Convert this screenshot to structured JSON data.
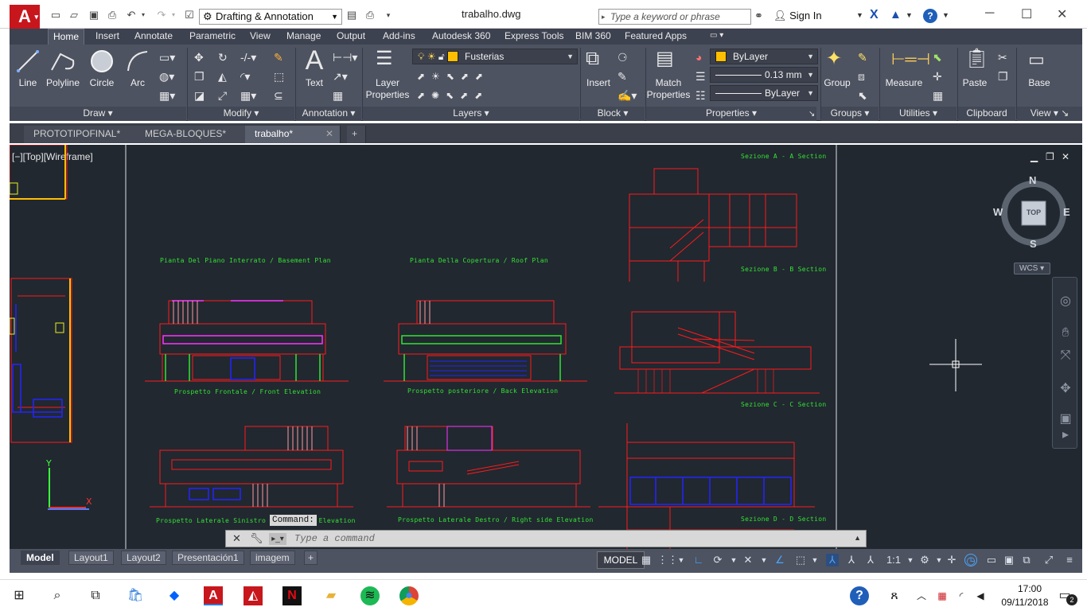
{
  "titlebar": {
    "app_logo": "A",
    "workspace": "Drafting & Annotation",
    "document_title": "trabalho.dwg",
    "search_placeholder": "Type a keyword or phrase",
    "signin_label": "Sign In"
  },
  "ribbon_tabs": [
    "Home",
    "Insert",
    "Annotate",
    "Parametric",
    "View",
    "Manage",
    "Output",
    "Add-ins",
    "Autodesk 360",
    "Express Tools",
    "BIM 360",
    "Featured Apps"
  ],
  "ribbon": {
    "draw": {
      "title": "Draw",
      "line": "Line",
      "polyline": "Polyline",
      "circle": "Circle",
      "arc": "Arc"
    },
    "modify": {
      "title": "Modify"
    },
    "annotation": {
      "title": "Annotation",
      "text": "Text"
    },
    "layers": {
      "title": "Layers",
      "layer_properties_1": "Layer",
      "layer_properties_2": "Properties",
      "current_layer": "Fusterias"
    },
    "block": {
      "title": "Block",
      "insert": "Insert"
    },
    "properties": {
      "title": "Properties",
      "match_1": "Match",
      "match_2": "Properties",
      "color": "ByLayer",
      "lineweight": "0.13 mm",
      "linetype": "ByLayer"
    },
    "groups": {
      "title": "Groups",
      "group": "Group"
    },
    "utilities": {
      "title": "Utilities",
      "measure": "Measure"
    },
    "clipboard": {
      "title": "Clipboard",
      "paste": "Paste"
    },
    "view": {
      "title": "View",
      "base": "Base"
    }
  },
  "file_tabs": [
    "PROTOTIPOFINAL*",
    "MEGA-BLOQUES*",
    "trabalho*"
  ],
  "canvas": {
    "viewport_label": "[−][Top][Wireframe]",
    "drawing_labels": {
      "section_a": "Sezione A - A Section",
      "section_b": "Sezione B - B Section",
      "section_c": "Sezione C - C Section",
      "section_d": "Sezione D - D Section",
      "basement_plan": "Pianta Del Piano Interrato / Basement Plan",
      "roof_plan": "Pianta Della Copertura / Roof Plan",
      "front_elevation": "Prospetto Frontale / Front Elevation",
      "back_elevation": "Prospetto posteriore / Back Elevation",
      "left_elevation": "Prospetto Laterale Sinistro / Left Side Elevation",
      "right_elevation": "Prospetto Laterale Destro / Right side Elevation"
    },
    "viewcube": {
      "n": "N",
      "s": "S",
      "e": "E",
      "w": "W",
      "face": "TOP"
    },
    "wcs": "WCS"
  },
  "command": {
    "history": "Command:",
    "placeholder": "Type a command"
  },
  "layout_tabs": [
    "Model",
    "Layout1",
    "Layout2",
    "Presentación1",
    "imagem"
  ],
  "status": {
    "model": "MODEL",
    "scale": "1:1"
  },
  "taskbar": {
    "time": "17:00",
    "date": "09/11/2018",
    "notifications": "2"
  },
  "colors": {
    "accent": "#c8161d",
    "canvas": "#212830",
    "ribbon": "#4d5361",
    "cad_red": "#ff1a1a",
    "cad_green": "#34e234",
    "cad_magenta": "#ff33ff",
    "cad_blue": "#2424ff",
    "layer_swatch": "#ffbf00"
  }
}
